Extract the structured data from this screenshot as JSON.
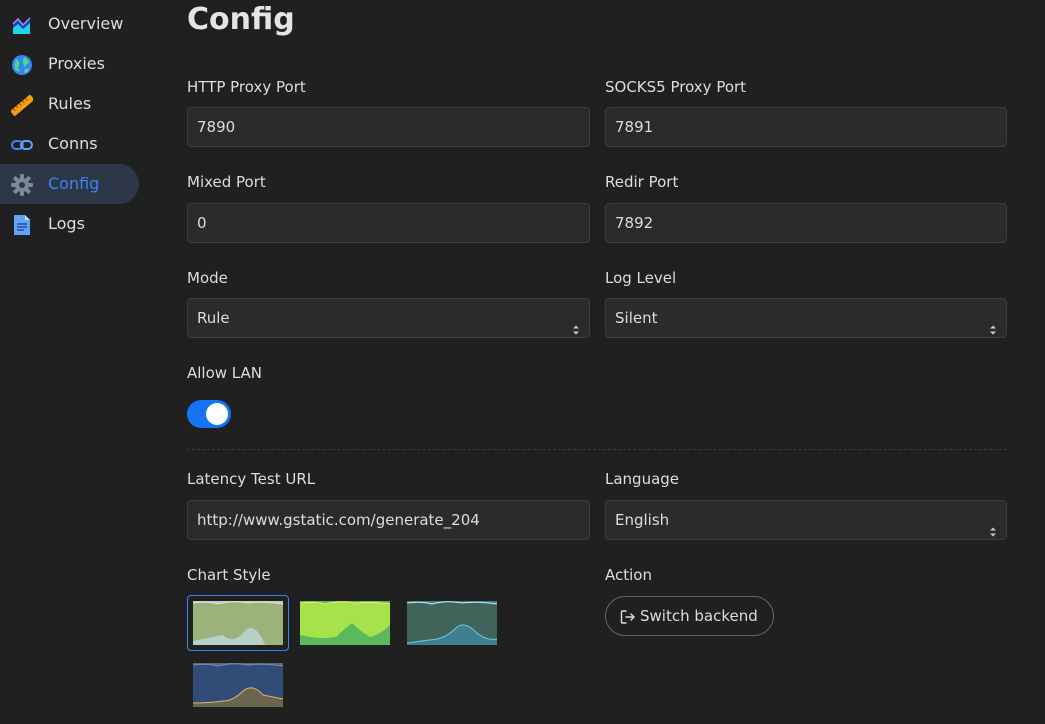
{
  "sidebar": {
    "items": [
      {
        "label": "Overview",
        "icon": "chart-icon"
      },
      {
        "label": "Proxies",
        "icon": "globe-icon"
      },
      {
        "label": "Rules",
        "icon": "ruler-icon"
      },
      {
        "label": "Conns",
        "icon": "link-icon"
      },
      {
        "label": "Config",
        "icon": "gear-icon",
        "active": true
      },
      {
        "label": "Logs",
        "icon": "document-icon"
      }
    ]
  },
  "main": {
    "title": "Config",
    "http_port": {
      "label": "HTTP Proxy Port",
      "value": "7890"
    },
    "socks_port": {
      "label": "SOCKS5 Proxy Port",
      "value": "7891"
    },
    "mixed_port": {
      "label": "Mixed Port",
      "value": "0"
    },
    "redir_port": {
      "label": "Redir Port",
      "value": "7892"
    },
    "mode": {
      "label": "Mode",
      "value": "Rule"
    },
    "log_level": {
      "label": "Log Level",
      "value": "Silent"
    },
    "allow_lan": {
      "label": "Allow LAN",
      "enabled": true
    },
    "latency_url": {
      "label": "Latency Test URL",
      "value": "http://www.gstatic.com/generate_204"
    },
    "language": {
      "label": "Language",
      "value": "English"
    },
    "chart_style": {
      "label": "Chart Style",
      "selected_index": 0
    },
    "action": {
      "label": "Action",
      "button_label": "Switch backend"
    }
  },
  "colors": {
    "accent": "#3b82f6",
    "toggle_on": "#1474f5",
    "background": "#202020"
  }
}
